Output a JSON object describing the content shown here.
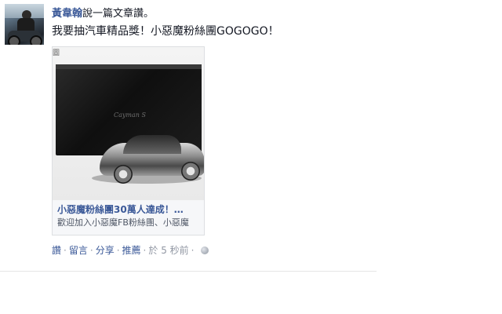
{
  "post": {
    "author": "黃韋翰",
    "action": "說一篇文章讚。",
    "message": "我要抽汽車精品獎！小惡魔粉絲團GOGOGO！"
  },
  "attachment": {
    "corner_text": "圖",
    "box_logo": "Cayman S",
    "title": "小惡魔粉絲團30萬人達成！…",
    "description": "歡迎加入小惡魔FB粉絲團、小惡魔"
  },
  "actions": {
    "like": "讚",
    "comment": "留言",
    "share": "分享",
    "promote": "推薦",
    "timestamp": "於 5 秒前",
    "sep": "·"
  },
  "icons": {
    "privacy": "globe-icon"
  }
}
